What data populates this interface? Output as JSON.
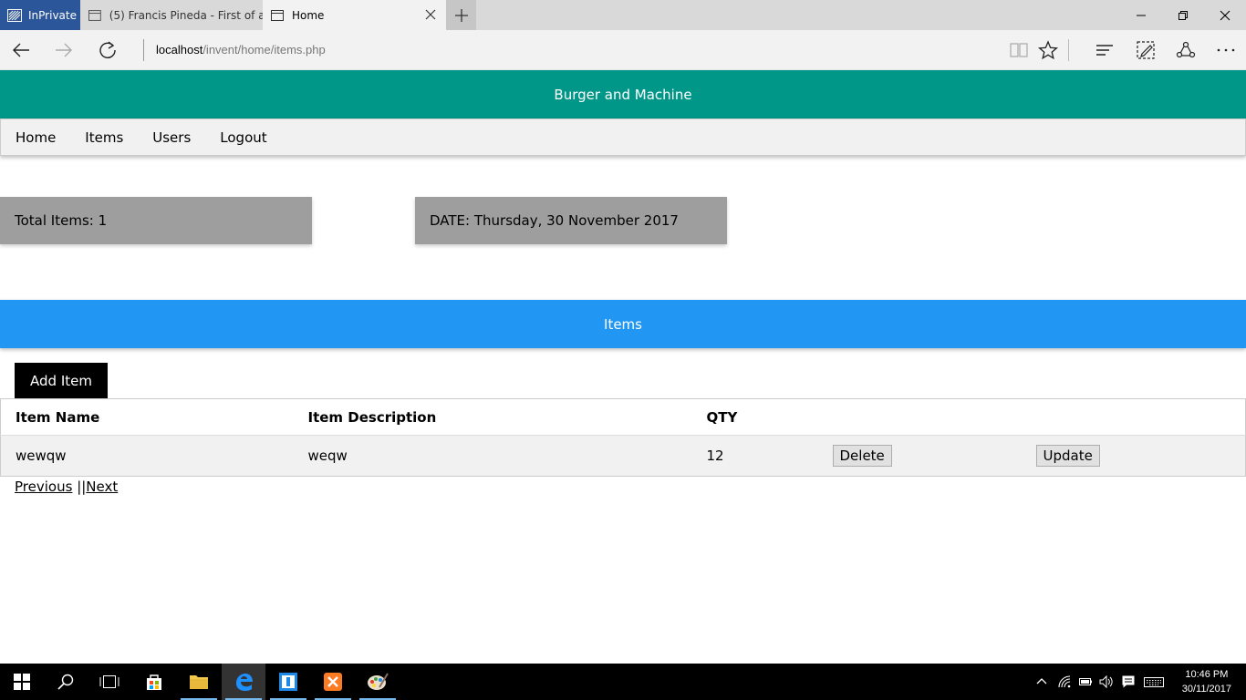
{
  "browser": {
    "inprivate_label": "InPrivate",
    "tabs": [
      {
        "title": "(5) Francis Pineda - First of a"
      },
      {
        "title": "Home"
      }
    ],
    "url_host": "localhost",
    "url_path": "/invent/home/items.php"
  },
  "page": {
    "site_title": "Burger and Machine",
    "nav": [
      "Home",
      "Items",
      "Users",
      "Logout"
    ],
    "total_items_label": "Total Items: 1",
    "date_label": "DATE: Thursday, 30 November 2017",
    "section_title": "Items",
    "add_item_label": "Add Item",
    "table": {
      "headers": [
        "Item Name",
        "Item Description",
        "QTY"
      ],
      "rows": [
        {
          "name": "wewqw",
          "description": "weqw",
          "qty": "12",
          "delete_label": "Delete",
          "update_label": "Update"
        }
      ]
    },
    "pager": {
      "previous": "Previous",
      "separator": "||",
      "next": "Next"
    }
  },
  "taskbar": {
    "time": "10:46 PM",
    "date": "30/11/2017"
  },
  "colors": {
    "header_teal": "#009688",
    "section_blue": "#2196f3",
    "card_grey": "#9e9e9e",
    "inprivate_blue": "#2b579a"
  }
}
